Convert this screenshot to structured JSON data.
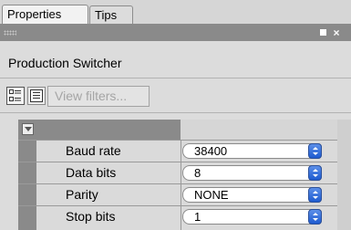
{
  "tabs": [
    {
      "label": "Properties"
    },
    {
      "label": "Tips"
    }
  ],
  "panel": {
    "title": "Production Switcher",
    "view_filters_label": "View filters..."
  },
  "properties": [
    {
      "label": "Baud rate",
      "value": "38400"
    },
    {
      "label": "Data bits",
      "value": "8"
    },
    {
      "label": "Parity",
      "value": "NONE"
    },
    {
      "label": "Stop bits",
      "value": "1"
    }
  ],
  "icons": {
    "minimize": "minimize-icon",
    "close": "close-icon",
    "categorized_view": "categorized-view-icon",
    "list_view": "list-view-icon",
    "collapse_group": "collapse-triangle-icon",
    "dropdown": "dropdown-arrow-icon"
  },
  "colors": {
    "title_bar": "#8a8a8a",
    "combo_arrow": "#2f6ee0"
  }
}
